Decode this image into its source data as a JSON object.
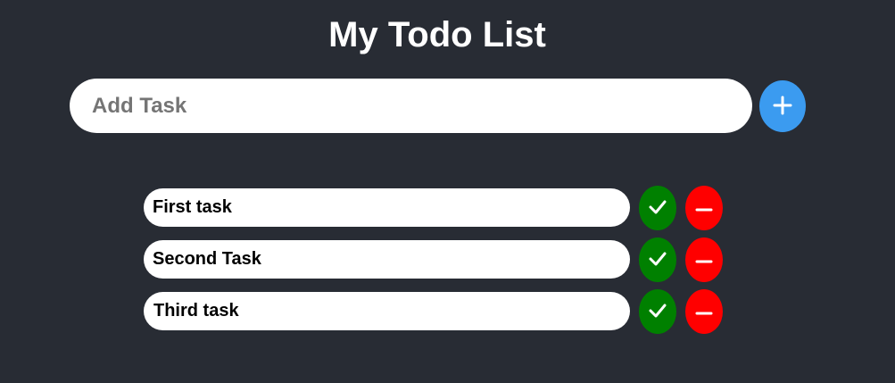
{
  "header": {
    "title": "My Todo List"
  },
  "add_task": {
    "placeholder": "Add Task",
    "value": "",
    "button_icon": "plus-icon"
  },
  "tasks": [
    {
      "text": "First task"
    },
    {
      "text": "Second Task"
    },
    {
      "text": "Third task"
    }
  ],
  "task_actions": {
    "complete_icon": "check-icon",
    "delete_icon": "minus-icon"
  },
  "colors": {
    "background": "#282c34",
    "add_button": "#3b9bf0",
    "complete_button": "#008000",
    "delete_button": "#ff0000",
    "task_background": "#ffffff"
  }
}
